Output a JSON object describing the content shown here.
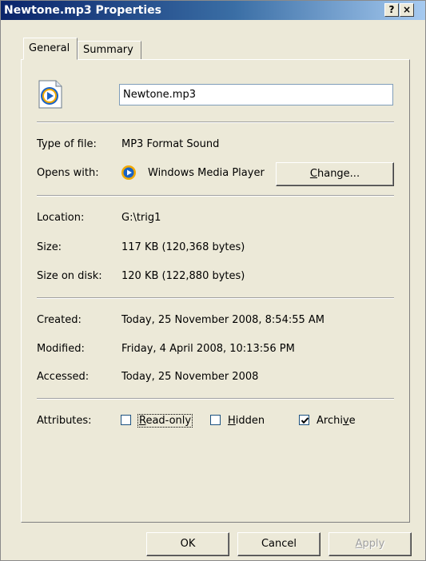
{
  "window": {
    "title": "Newtone.mp3 Properties",
    "help_label": "?",
    "close_label": "×"
  },
  "tabs": [
    {
      "label": "General",
      "active": true
    },
    {
      "label": "Summary",
      "active": false
    }
  ],
  "file": {
    "icon": "windows-media-file-icon",
    "name": "Newtone.mp3"
  },
  "type_section": {
    "type_label": "Type of file:",
    "type_value": "MP3 Format Sound",
    "opens_label": "Opens with:",
    "opens_icon": "windows-media-player-icon",
    "opens_value": "Windows Media Player",
    "change_prefix": "",
    "change_underlined": "C",
    "change_suffix": "hange..."
  },
  "location_section": {
    "location_label": "Location:",
    "location_value": "G:\\trig1",
    "size_label": "Size:",
    "size_value": "117 KB (120,368 bytes)",
    "size_disk_label": "Size on disk:",
    "size_disk_value": "120 KB (122,880 bytes)"
  },
  "dates_section": {
    "created_label": "Created:",
    "created_value": "Today, 25 November 2008, 8:54:55 AM",
    "modified_label": "Modified:",
    "modified_value": "Friday, 4 April 2008, 10:13:56 PM",
    "accessed_label": "Accessed:",
    "accessed_value": "Today, 25 November 2008"
  },
  "attributes": {
    "label": "Attributes:",
    "read_only": {
      "u": "R",
      "rest": "ead-only",
      "checked": false
    },
    "hidden": {
      "u": "H",
      "rest": "idden",
      "checked": false
    },
    "archive": {
      "pre": "Archi",
      "u": "v",
      "rest": "e",
      "checked": true
    }
  },
  "buttons": {
    "ok": "OK",
    "cancel": "Cancel",
    "apply_u": "A",
    "apply_rest": "pply",
    "apply_enabled": false
  },
  "colors": {
    "title_start": "#0a246a",
    "title_end": "#a6caf0",
    "face": "#ece9d8"
  }
}
